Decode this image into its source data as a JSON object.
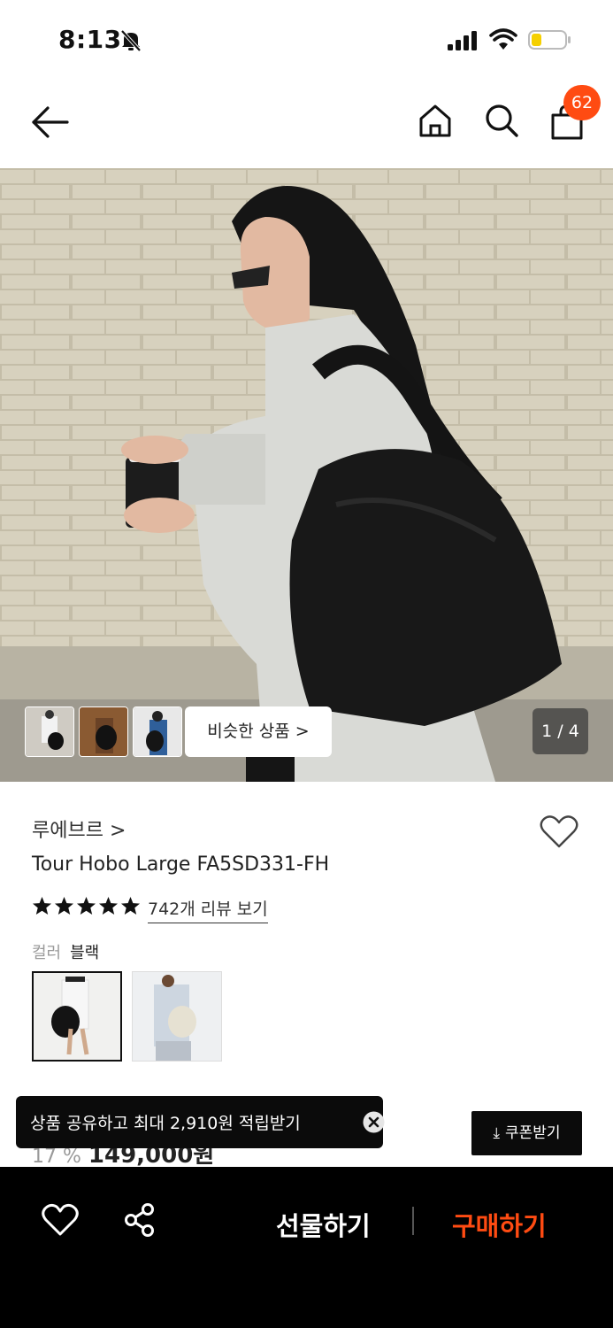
{
  "status_bar": {
    "time": "8:13",
    "icons": [
      "bell-slash-icon",
      "cellular-signal-icon",
      "wifi-icon",
      "battery-low-icon"
    ]
  },
  "nav": {
    "icons": [
      "back-arrow-icon",
      "home-icon",
      "search-icon",
      "shopping-bag-icon"
    ],
    "cart_count": "62"
  },
  "gallery": {
    "similar_button_label": "비슷한 상품 >",
    "page_indicator": "1 / 4",
    "current_page": 1,
    "total_pages": 4
  },
  "product": {
    "brand": "루에브르 >",
    "name": "Tour Hobo Large FA5SD331-FH",
    "rating_stars": 5,
    "review_link": "742개 리뷰 보기",
    "color_label": "컬러",
    "color_value": "블랙",
    "price_peek_pct": "17 %",
    "price_peek": "149,000원"
  },
  "toast": {
    "text": "상품 공유하고 최대 2,910원 적립받기"
  },
  "coupon": {
    "label": "쿠폰받기"
  },
  "bottom_bar": {
    "gift_label": "선물하기",
    "buy_label": "구매하기"
  },
  "colors": {
    "accent": "#ff4b12",
    "dark": "#0b0b0b"
  }
}
